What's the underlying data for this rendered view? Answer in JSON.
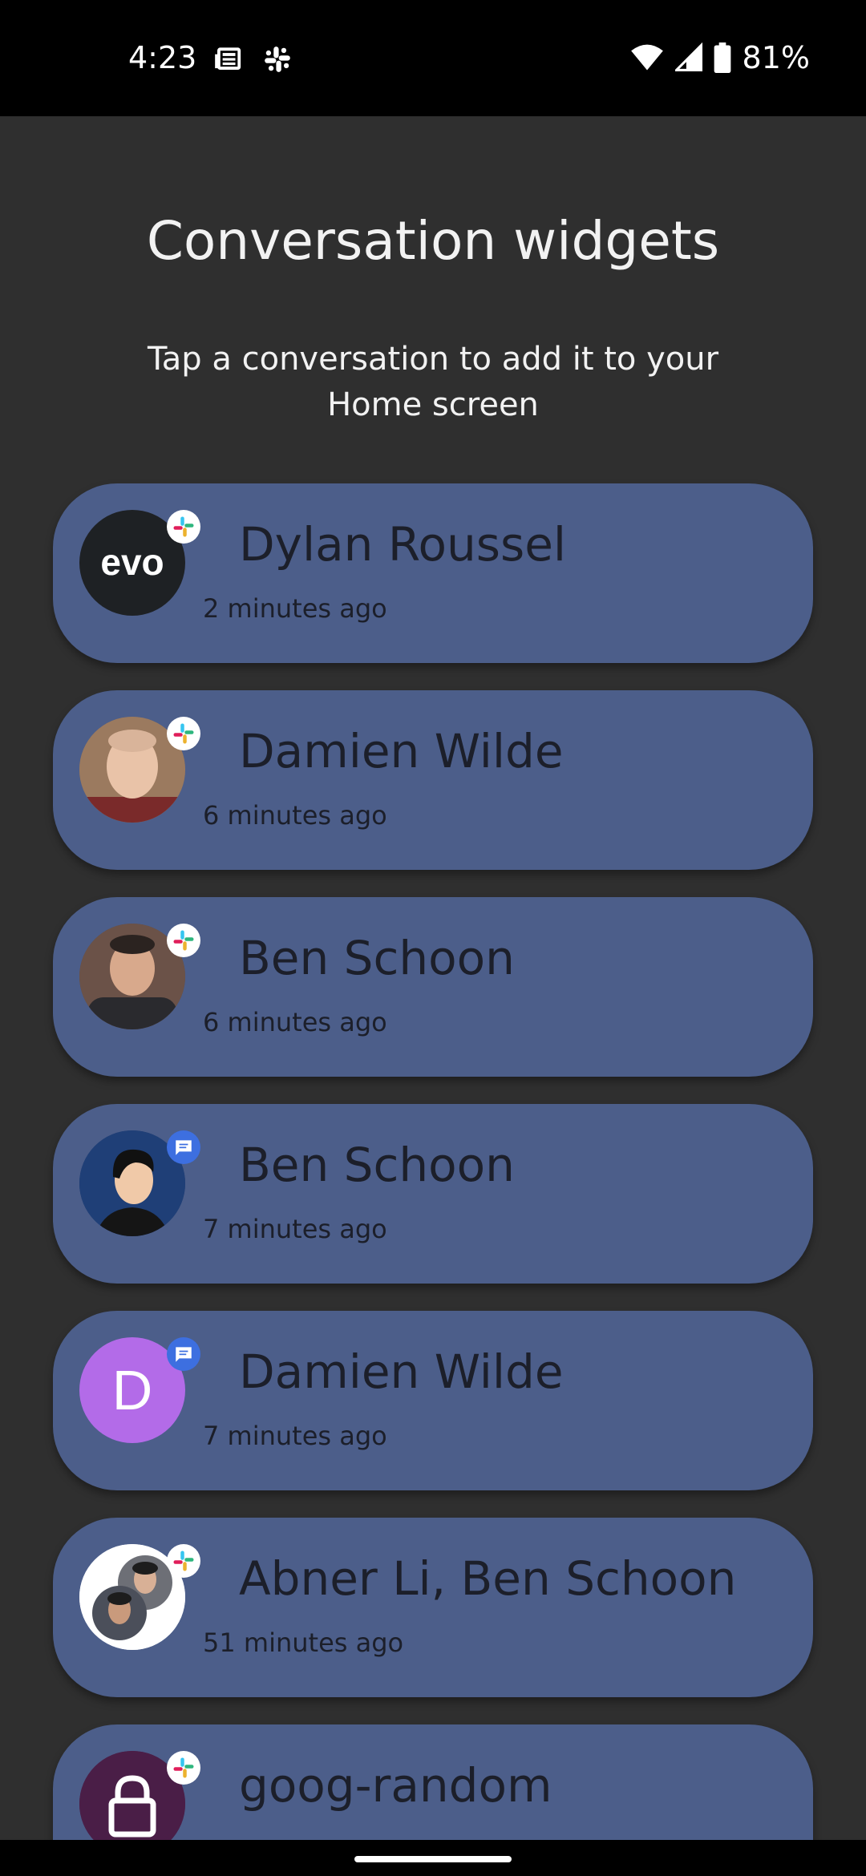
{
  "status_bar": {
    "time": "4:23",
    "battery": "81%",
    "icons": [
      "news-icon",
      "slack-icon",
      "wifi-icon",
      "signal-icon",
      "battery-icon"
    ]
  },
  "header": {
    "title": "Conversation widgets",
    "subtitle": "Tap a conversation to add it to your Home screen"
  },
  "conversations": [
    {
      "name": "Dylan Roussel",
      "time": "2 minutes ago",
      "avatar": "evo",
      "app": "slack"
    },
    {
      "name": "Damien Wilde",
      "time": "6 minutes ago",
      "avatar": "photo",
      "app": "slack"
    },
    {
      "name": "Ben Schoon",
      "time": "6 minutes ago",
      "avatar": "photo",
      "app": "slack"
    },
    {
      "name": "Ben Schoon",
      "time": "7 minutes ago",
      "avatar": "silhouette",
      "app": "messages"
    },
    {
      "name": "Damien Wilde",
      "time": "7 minutes ago",
      "avatar": "D",
      "app": "messages"
    },
    {
      "name": "Abner Li, Ben Schoon",
      "time": "51 minutes ago",
      "avatar": "group",
      "app": "slack"
    },
    {
      "name": "goog-random",
      "time": "",
      "avatar": "lock",
      "app": "slack"
    }
  ],
  "colors": {
    "background": "#2f2f2f",
    "card": "#4c5e8a",
    "card_text": "#1c1f2a",
    "messages_badge": "#3d6fe0",
    "letter_avatar": "#b36be8",
    "lock_avatar": "#4a1e47"
  }
}
